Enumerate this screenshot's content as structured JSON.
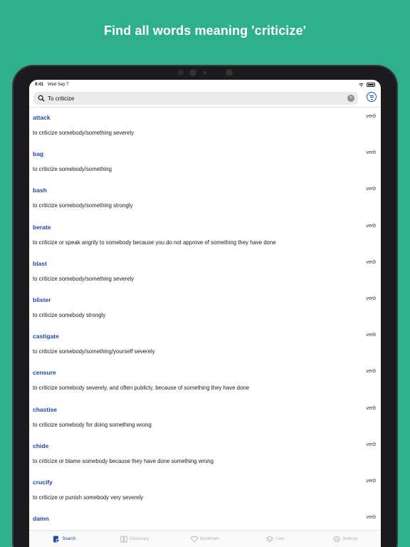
{
  "headline": "Find all words meaning 'criticize'",
  "status": {
    "time": "9:41",
    "date": "Wed Sep 7"
  },
  "search": {
    "value": "To criticize"
  },
  "entries": [
    {
      "word": "attack",
      "pos": "verb",
      "def": "to criticize somebody/something severely"
    },
    {
      "word": "bag",
      "pos": "verb",
      "def": "to criticize somebody/something"
    },
    {
      "word": "bash",
      "pos": "verb",
      "def": "to criticize somebody/something strongly"
    },
    {
      "word": "berate",
      "pos": "verb",
      "def": "to criticize or speak angrily to somebody because you do not approve of something they have done"
    },
    {
      "word": "blast",
      "pos": "verb",
      "def": "to criticize somebody/something severely"
    },
    {
      "word": "blister",
      "pos": "verb",
      "def": "to criticize somebody strongly"
    },
    {
      "word": "castigate",
      "pos": "verb",
      "def": "to criticize somebody/something/yourself severely"
    },
    {
      "word": "censure",
      "pos": "verb",
      "def": "to criticize somebody severely, and often publicly, because of something they have done"
    },
    {
      "word": "chastise",
      "pos": "verb",
      "def": "to criticize somebody for doing something wrong"
    },
    {
      "word": "chide",
      "pos": "verb",
      "def": "to criticize or blame somebody because they have done something wrong"
    },
    {
      "word": "crucify",
      "pos": "verb",
      "def": "to criticize or punish somebody very severely"
    },
    {
      "word": "damn",
      "pos": "verb",
      "def": ""
    }
  ],
  "tabs": [
    {
      "label": "Search",
      "icon": "search-icon"
    },
    {
      "label": "Dictionary",
      "icon": "dictionary-icon"
    },
    {
      "label": "Bookmark",
      "icon": "heart-icon"
    },
    {
      "label": "Lists",
      "icon": "layers-icon"
    },
    {
      "label": "Settings",
      "icon": "settings-icon"
    }
  ],
  "colors": {
    "background": "#2fb08c",
    "accent": "#1f48a9",
    "inactive": "#b4b4b8"
  }
}
